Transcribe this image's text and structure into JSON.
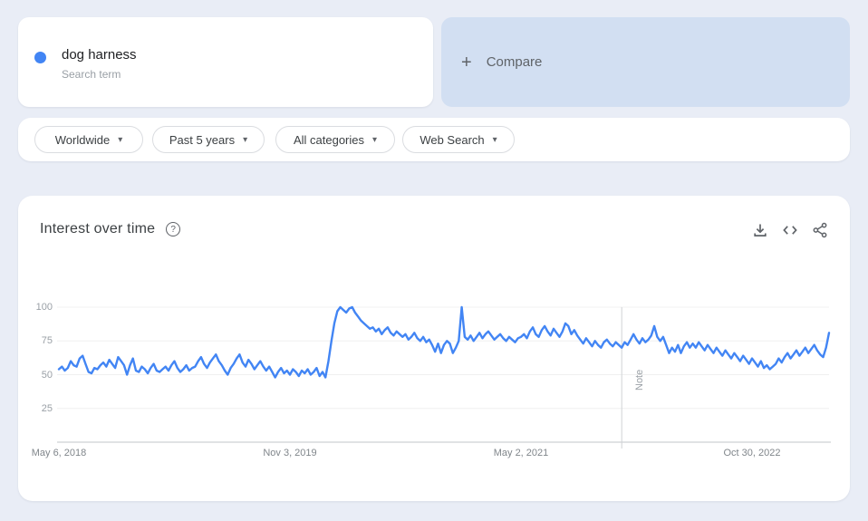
{
  "colors": {
    "accent": "#4285f4",
    "page_bg": "#e9edf6",
    "compare_bg": "#d2dff2",
    "grid": "#f0f0f0",
    "axis_line": "#c2c5c9",
    "note_line": "#d0d3d6"
  },
  "glyphs": {
    "caret": "▾",
    "plus": "+",
    "help": "?"
  },
  "term_card": {
    "term": "dog harness",
    "subtitle": "Search term"
  },
  "compare_card": {
    "label": "Compare"
  },
  "filters": [
    {
      "label": "Worldwide"
    },
    {
      "label": "Past 5 years"
    },
    {
      "label": "All categories"
    },
    {
      "label": "Web Search"
    }
  ],
  "toolbar_icons": [
    "download",
    "embed",
    "share"
  ],
  "chart_data": {
    "type": "line",
    "title": "Interest over time",
    "series_name": "dog harness",
    "legend_position": "none",
    "grid": "horizontal",
    "ylim": [
      0,
      100
    ],
    "y_ticks": [
      "100",
      "75",
      "50",
      "25"
    ],
    "x_tick_labels": [
      "May 6, 2018",
      "Nov 3, 2019",
      "May 2, 2021",
      "Oct 30, 2022"
    ],
    "x_tick_weeks": [
      0,
      78,
      156,
      234
    ],
    "note_week": 190,
    "note_label": "Note",
    "line_color": "#4285f4",
    "x_unit": "week",
    "values": [
      54,
      56,
      53,
      55,
      60,
      57,
      56,
      62,
      64,
      58,
      52,
      51,
      55,
      54,
      57,
      59,
      56,
      61,
      58,
      55,
      63,
      60,
      57,
      50,
      57,
      62,
      53,
      52,
      56,
      54,
      51,
      55,
      58,
      53,
      52,
      54,
      56,
      53,
      57,
      60,
      55,
      52,
      54,
      57,
      53,
      55,
      56,
      60,
      63,
      58,
      55,
      59,
      62,
      65,
      60,
      57,
      53,
      50,
      55,
      58,
      62,
      65,
      59,
      56,
      61,
      58,
      54,
      57,
      60,
      56,
      53,
      56,
      52,
      48,
      52,
      55,
      51,
      53,
      50,
      54,
      52,
      49,
      53,
      51,
      54,
      50,
      52,
      55,
      49,
      52,
      48,
      60,
      75,
      88,
      97,
      100,
      98,
      96,
      99,
      100,
      96,
      93,
      90,
      88,
      86,
      84,
      85,
      82,
      84,
      80,
      83,
      85,
      81,
      79,
      82,
      80,
      78,
      80,
      76,
      78,
      81,
      77,
      75,
      78,
      74,
      76,
      72,
      67,
      73,
      66,
      72,
      75,
      73,
      66,
      70,
      75,
      100,
      78,
      76,
      79,
      75,
      78,
      81,
      77,
      80,
      82,
      79,
      76,
      78,
      80,
      77,
      75,
      78,
      76,
      74,
      77,
      78,
      80,
      77,
      82,
      85,
      80,
      78,
      83,
      86,
      82,
      79,
      84,
      81,
      78,
      82,
      88,
      86,
      80,
      83,
      79,
      76,
      73,
      77,
      74,
      71,
      75,
      72,
      70,
      74,
      76,
      73,
      71,
      74,
      72,
      70,
      74,
      72,
      76,
      80,
      76,
      73,
      77,
      74,
      76,
      79,
      86,
      78,
      75,
      78,
      72,
      66,
      70,
      67,
      72,
      66,
      71,
      74,
      70,
      73,
      70,
      74,
      71,
      68,
      72,
      69,
      66,
      70,
      67,
      64,
      68,
      65,
      62,
      66,
      63,
      60,
      64,
      61,
      58,
      62,
      59,
      56,
      60,
      55,
      57,
      54,
      56,
      58,
      62,
      59,
      63,
      66,
      62,
      65,
      68,
      64,
      67,
      70,
      66,
      69,
      72,
      68,
      65,
      63,
      70,
      81
    ]
  }
}
